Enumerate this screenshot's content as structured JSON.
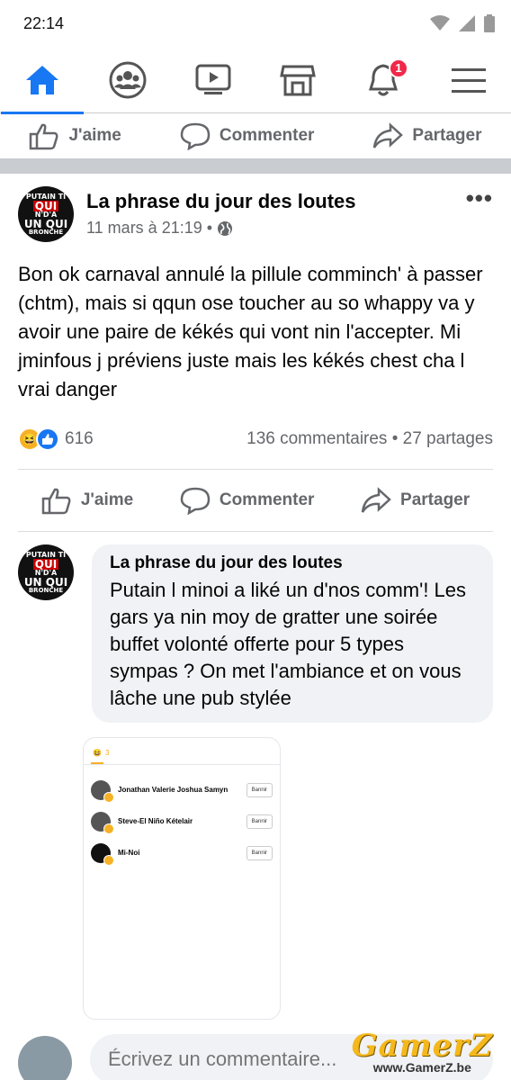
{
  "status": {
    "time": "22:14"
  },
  "nav": {
    "notifications_count": "1"
  },
  "top_actions": {
    "like": "J'aime",
    "comment": "Commenter",
    "share": "Partager"
  },
  "post": {
    "author": "La phrase du jour des loutes",
    "time": "11 mars à 21:19 •",
    "text": "Bon ok carnaval annulé la pillule comminch' à passer (chtm), mais si qqun ose toucher au so whappy va y avoir une paire de kékés qui vont nin l'accepter. Mi jminfous j préviens juste mais les kékés chest cha l vrai danger",
    "reactions_count": "616",
    "stats": "136 commentaires • 27 partages",
    "actions": {
      "like": "J'aime",
      "comment": "Commenter",
      "share": "Partager"
    }
  },
  "avatar_text": {
    "l1": "PUTAIN TI",
    "l2": "QUI",
    "l2b": "N'D'A",
    "l3": "UN QUI",
    "l4": "BRONCHE"
  },
  "comment": {
    "author": "La phrase du jour des loutes",
    "text": "Putain l minoi a liké un d'nos comm'! Les gars ya nin moy de gratter une soirée buffet volonté offerte pour 5 types sympas ? On met l'ambiance et on vous lâche une pub stylée"
  },
  "attachment": {
    "count": "3",
    "rows": [
      {
        "name": "Jonathan Valerie Joshua Samyn",
        "button": "Bannir"
      },
      {
        "name": "Steve-El Niño Kételair",
        "button": "Bannir"
      },
      {
        "name": "Mi-Noi",
        "button": "Bannir"
      }
    ]
  },
  "compose": {
    "placeholder": "Écrivez un commentaire..."
  },
  "watermark": {
    "logo": "GamerZ",
    "url": "www.GamerZ.be"
  },
  "colors": {
    "accent": "#1877f2",
    "badge": "#f02849",
    "haha": "#f7b125"
  }
}
